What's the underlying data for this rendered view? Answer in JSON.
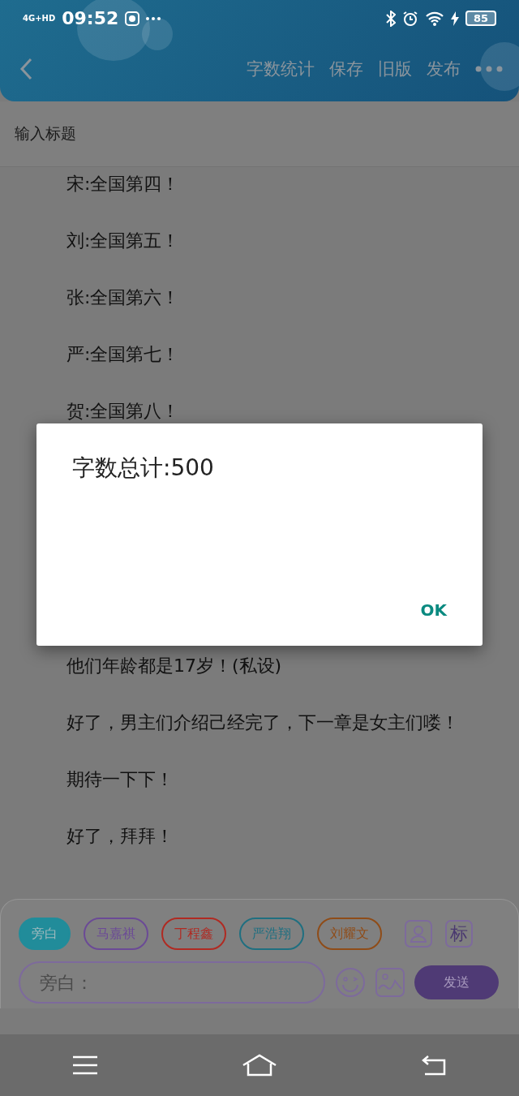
{
  "status_bar": {
    "network": "4G+HD",
    "time": "09:52",
    "battery": "85"
  },
  "toolbar": {
    "actions": [
      "字数统计",
      "保存",
      "旧版",
      "发布"
    ]
  },
  "title_field": {
    "placeholder": "输入标题"
  },
  "paragraphs_top": [
    "宋:全国第四！",
    "刘:全国第五！",
    "张:全国第六！",
    "严:全国第七！",
    "贺:全国第八！"
  ],
  "paragraphs_bottom": [
    "他们年龄都是17岁！(私设)",
    "好了，男主们介绍己经完了，下一章是女主们喽！",
    "期待一下下！",
    "好了，拜拜！"
  ],
  "speakers": [
    {
      "label": "旁白",
      "color": "#218c9a",
      "selected": true
    },
    {
      "label": "马嘉祺",
      "color": "#6b4a96",
      "selected": false
    },
    {
      "label": "丁程鑫",
      "color": "#b02a22",
      "selected": false
    },
    {
      "label": "严浩翔",
      "color": "#1f6f80",
      "selected": false
    },
    {
      "label": "刘耀文",
      "color": "#8f4c18",
      "selected": false
    }
  ],
  "tag_button": "标",
  "message_field": {
    "placeholder": "旁白："
  },
  "send_button": "发送",
  "dialog": {
    "title": "字数总计:500",
    "button": "OK"
  }
}
